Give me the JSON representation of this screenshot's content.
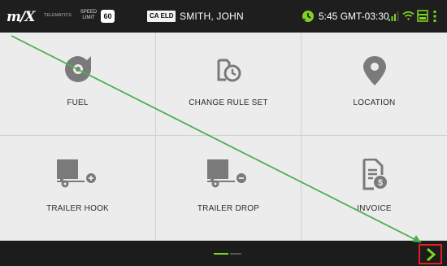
{
  "status_bar": {
    "logo": "m/X",
    "logo_sub": "TELEMATICS",
    "speed_label_line1": "SPEED",
    "speed_label_line2": "LIMIT",
    "speed_limit": "60",
    "region_badge": "CA ELD",
    "driver_name": "SMITH, JOHN",
    "time": "5:45 GMT-03:30",
    "icons": [
      "clock-icon",
      "signal-icon",
      "wifi-icon",
      "battery-icon",
      "more-vert-icon"
    ]
  },
  "tiles": [
    {
      "label": "FUEL",
      "icon": "fuel-icon"
    },
    {
      "label": "CHANGE RULE SET",
      "icon": "change-rule-set-icon"
    },
    {
      "label": "LOCATION",
      "icon": "location-pin-icon"
    },
    {
      "label": "TRAILER HOOK",
      "icon": "trailer-hook-icon"
    },
    {
      "label": "TRAILER DROP",
      "icon": "trailer-drop-icon"
    },
    {
      "label": "INVOICE",
      "icon": "invoice-icon"
    }
  ],
  "pager": {
    "current_page": 1,
    "total_pages": 2
  },
  "colors": {
    "accent": "#7ed321",
    "icon_gray": "#7a7a7a",
    "highlight": "#e02020",
    "annotation_line": "#4caf50"
  }
}
